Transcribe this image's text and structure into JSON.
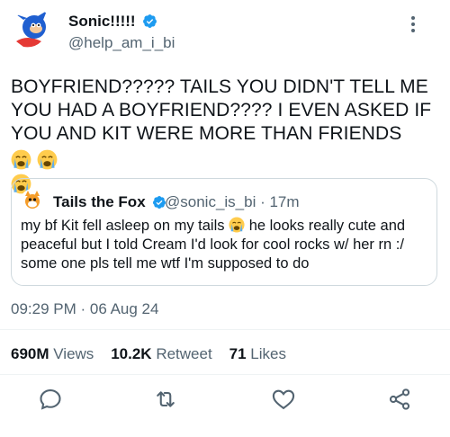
{
  "tweet": {
    "display_name": "Sonic!!!!!",
    "handle": "@help_am_i_bi",
    "text_line1": "BOYFRIEND????? TAILS YOU DIDN'T TELL ME",
    "text_line2": "YOU HAD A BOYFRIEND???? I EVEN ASKED IF",
    "text_line3": "YOU AND KIT WERE MORE THAN FRIENDS",
    "emoji": "loudly-crying-face-icon"
  },
  "quote": {
    "display_name": "Tails the Fox",
    "handle_time": "@sonic_is_bi · 17m",
    "text_line1a": "my bf Kit fell asleep on my tails",
    "text_line1b": "he looks really cute and",
    "text_line2": "peaceful but I told Cream I'd look for cool rocks w/ her rn :/",
    "text_line3": "some one pls tell me wtf I'm supposed to do"
  },
  "timestamp": "09:29 PM · 06 Aug 24",
  "stats": {
    "views_value": "690M",
    "views_label": "Views",
    "retweets_value": "10.2K",
    "retweets_label": "Retweet",
    "likes_value": "71",
    "likes_label": "Likes"
  },
  "colors": {
    "verified_blue": "#1d9bf0",
    "secondary_text": "#536471",
    "border": "#cfd9de"
  }
}
